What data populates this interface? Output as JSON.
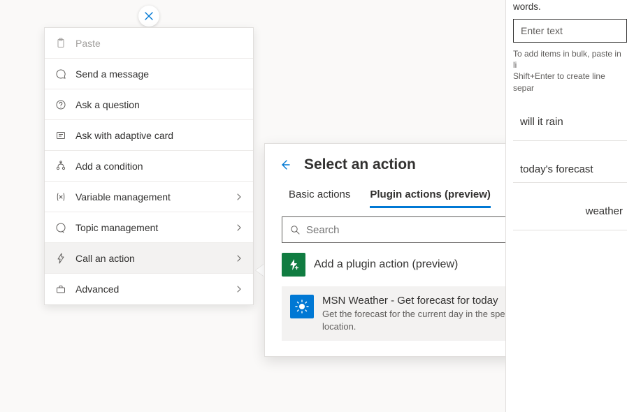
{
  "close_chip": "close-icon",
  "context_menu": {
    "items": [
      {
        "label": "Paste",
        "icon": "clipboard-icon",
        "disabled": true,
        "submenu": false
      },
      {
        "label": "Send a message",
        "icon": "chat-icon",
        "disabled": false,
        "submenu": false
      },
      {
        "label": "Ask a question",
        "icon": "question-circle-icon",
        "disabled": false,
        "submenu": false
      },
      {
        "label": "Ask with adaptive card",
        "icon": "card-icon",
        "disabled": false,
        "submenu": false
      },
      {
        "label": "Add a condition",
        "icon": "branch-icon",
        "disabled": false,
        "submenu": false
      },
      {
        "label": "Variable management",
        "icon": "variable-icon",
        "disabled": false,
        "submenu": true
      },
      {
        "label": "Topic management",
        "icon": "topic-icon",
        "disabled": false,
        "submenu": true
      },
      {
        "label": "Call an action",
        "icon": "lightning-icon",
        "disabled": false,
        "submenu": true,
        "active": true
      },
      {
        "label": "Advanced",
        "icon": "toolbox-icon",
        "disabled": false,
        "submenu": true
      }
    ]
  },
  "panel": {
    "title": "Select an action",
    "tabs": {
      "basic": "Basic actions",
      "plugin": "Plugin actions (preview)",
      "selected": "plugin"
    },
    "search_placeholder": "Search",
    "add_plugin_label": "Add a plugin action (preview)",
    "result": {
      "title": "MSN Weather - Get forecast for today",
      "description": "Get the forecast for the current day in the specified location."
    }
  },
  "sidebar": {
    "truncated_top": "words.",
    "input_placeholder": "Enter text",
    "hint_line1": "To add items in bulk, paste in li",
    "hint_line2": "Shift+Enter to create line separ",
    "phrases": [
      "will it rain",
      "today's forecast",
      "weather"
    ]
  }
}
